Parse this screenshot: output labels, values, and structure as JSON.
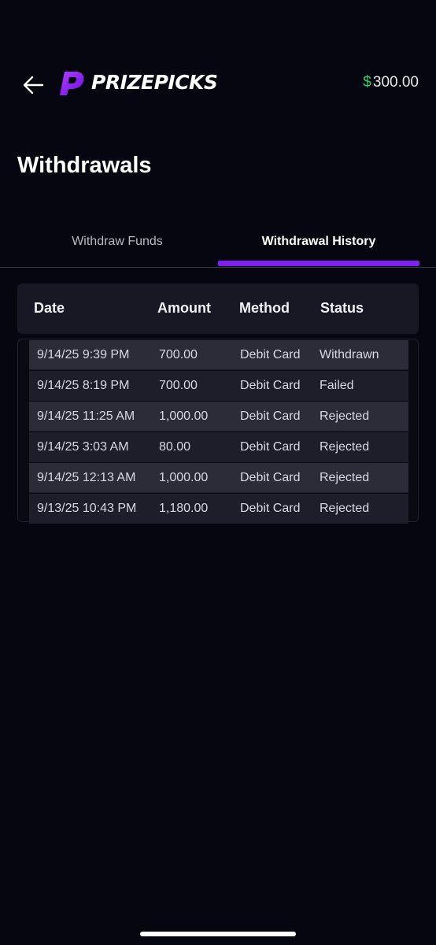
{
  "header": {
    "brand": "PRIZEPICKS",
    "balance_symbol": "$",
    "balance_value": "300.00",
    "back_icon": "arrow-left-icon",
    "logo_icon": "prizepicks-logo-icon"
  },
  "page": {
    "title": "Withdrawals"
  },
  "tabs": [
    {
      "label": "Withdraw Funds",
      "active": false
    },
    {
      "label": "Withdrawal History",
      "active": true
    }
  ],
  "table": {
    "columns": [
      "Date",
      "Amount",
      "Method",
      "Status"
    ],
    "rows": [
      {
        "date": "9/14/25 9:39 PM",
        "amount": "700.00",
        "method": "Debit Card",
        "status": "Withdrawn"
      },
      {
        "date": "9/14/25 8:19 PM",
        "amount": "700.00",
        "method": "Debit Card",
        "status": "Failed"
      },
      {
        "date": "9/14/25 11:25 AM",
        "amount": "1,000.00",
        "method": "Debit Card",
        "status": "Rejected"
      },
      {
        "date": "9/14/25 3:03 AM",
        "amount": "80.00",
        "method": "Debit Card",
        "status": "Rejected"
      },
      {
        "date": "9/14/25 12:13 AM",
        "amount": "1,000.00",
        "method": "Debit Card",
        "status": "Rejected"
      },
      {
        "date": "9/13/25 10:43 PM",
        "amount": "1,180.00",
        "method": "Debit Card",
        "status": "Rejected"
      }
    ]
  },
  "colors": {
    "background": "#05060f",
    "accent": "#7f1ff0",
    "balance_symbol": "#33d06a"
  }
}
